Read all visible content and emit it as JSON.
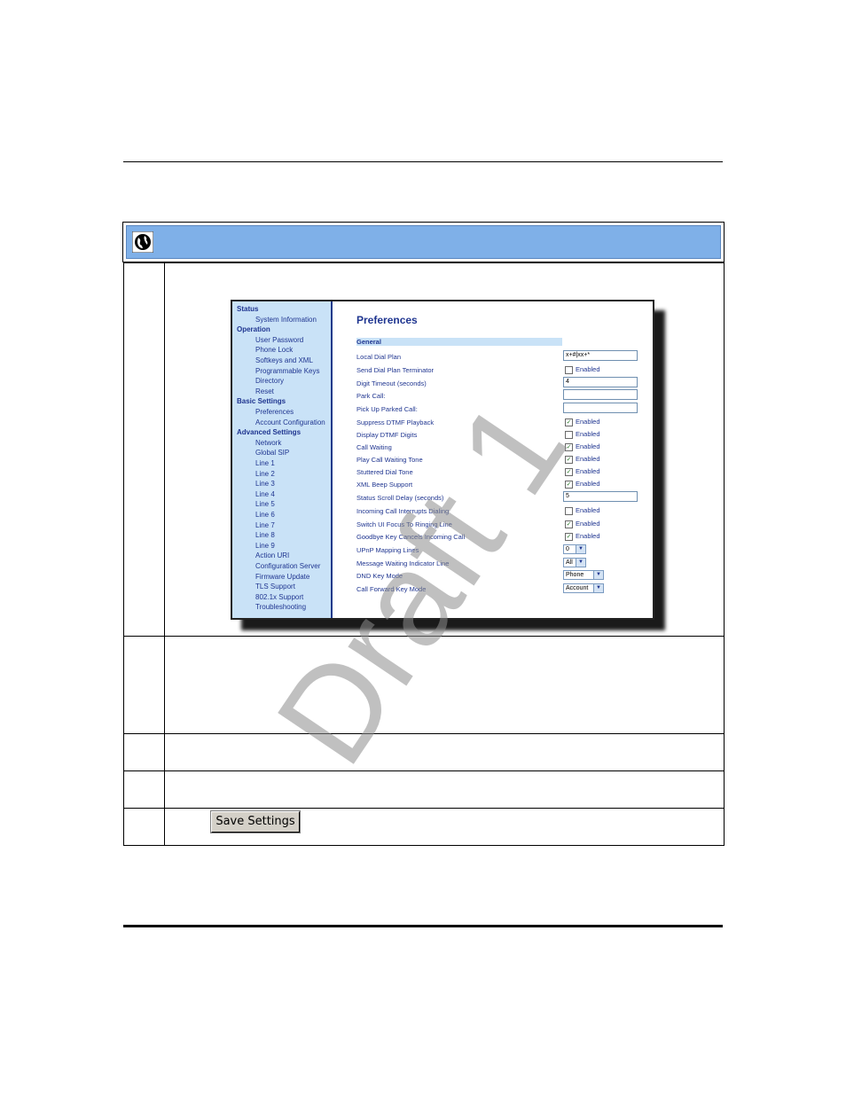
{
  "banner": {
    "icon": "globe-icon"
  },
  "screen": {
    "sidebar": [
      {
        "type": "h",
        "label": "Status"
      },
      {
        "type": "i",
        "label": "System Information"
      },
      {
        "type": "h",
        "label": "Operation"
      },
      {
        "type": "i",
        "label": "User Password"
      },
      {
        "type": "i",
        "label": "Phone Lock"
      },
      {
        "type": "i",
        "label": "Softkeys and XML"
      },
      {
        "type": "i",
        "label": "Programmable Keys"
      },
      {
        "type": "i",
        "label": "Directory"
      },
      {
        "type": "i",
        "label": "Reset"
      },
      {
        "type": "h",
        "label": "Basic Settings"
      },
      {
        "type": "i",
        "label": "Preferences"
      },
      {
        "type": "i",
        "label": "Account Configuration"
      },
      {
        "type": "h",
        "label": "Advanced Settings"
      },
      {
        "type": "i",
        "label": "Network"
      },
      {
        "type": "i",
        "label": "Global SIP"
      },
      {
        "type": "i",
        "label": "Line 1"
      },
      {
        "type": "i",
        "label": "Line 2"
      },
      {
        "type": "i",
        "label": "Line 3"
      },
      {
        "type": "i",
        "label": "Line 4"
      },
      {
        "type": "i",
        "label": "Line 5"
      },
      {
        "type": "i",
        "label": "Line 6"
      },
      {
        "type": "i",
        "label": "Line 7"
      },
      {
        "type": "i",
        "label": "Line 8"
      },
      {
        "type": "i",
        "label": "Line 9"
      },
      {
        "type": "i",
        "label": "Action URI"
      },
      {
        "type": "i",
        "label": "Configuration Server"
      },
      {
        "type": "i",
        "label": "Firmware Update"
      },
      {
        "type": "i",
        "label": "TLS Support"
      },
      {
        "type": "i",
        "label": "802.1x Support"
      },
      {
        "type": "i",
        "label": "Troubleshooting"
      }
    ],
    "title": "Preferences",
    "group": "General",
    "rows": [
      {
        "label": "Local Dial Plan",
        "kind": "text",
        "value": "x+#|xx+*"
      },
      {
        "label": "Send Dial Plan Terminator",
        "kind": "check",
        "checked": false,
        "value": "Enabled"
      },
      {
        "label": "Digit Timeout (seconds)",
        "kind": "text",
        "value": "4"
      },
      {
        "label": "Park Call:",
        "kind": "text",
        "value": ""
      },
      {
        "label": "Pick Up Parked Call:",
        "kind": "text",
        "value": ""
      },
      {
        "label": "Suppress DTMF Playback",
        "kind": "check",
        "checked": true,
        "value": "Enabled"
      },
      {
        "label": "Display DTMF Digits",
        "kind": "check",
        "checked": false,
        "value": "Enabled"
      },
      {
        "label": "Call Waiting",
        "kind": "check",
        "checked": true,
        "value": "Enabled"
      },
      {
        "label": "Play Call Waiting Tone",
        "kind": "check",
        "checked": true,
        "value": "Enabled"
      },
      {
        "label": "Stuttered Dial Tone",
        "kind": "check",
        "checked": true,
        "value": "Enabled"
      },
      {
        "label": "XML Beep Support",
        "kind": "check",
        "checked": true,
        "value": "Enabled"
      },
      {
        "label": "Status Scroll Delay (seconds)",
        "kind": "text",
        "value": "5"
      },
      {
        "label": "Incoming Call Interrupts Dialing",
        "kind": "check",
        "checked": false,
        "value": "Enabled"
      },
      {
        "label": "Switch UI Focus To Ringing Line",
        "kind": "check",
        "checked": true,
        "value": "Enabled"
      },
      {
        "label": "Goodbye Key Cancels Incoming Call",
        "kind": "check",
        "checked": true,
        "value": "Enabled"
      },
      {
        "label": "UPnP Mapping Lines",
        "kind": "select",
        "value": "0"
      },
      {
        "label": "Message Waiting Indicator Line",
        "kind": "select",
        "value": "All"
      },
      {
        "label": "DND Key Mode",
        "kind": "select",
        "value": "Phone"
      },
      {
        "label": "Call Forward Key Mode",
        "kind": "select",
        "value": "Account"
      }
    ]
  },
  "watermark": "Draft 1",
  "save_button": "Save Settings"
}
